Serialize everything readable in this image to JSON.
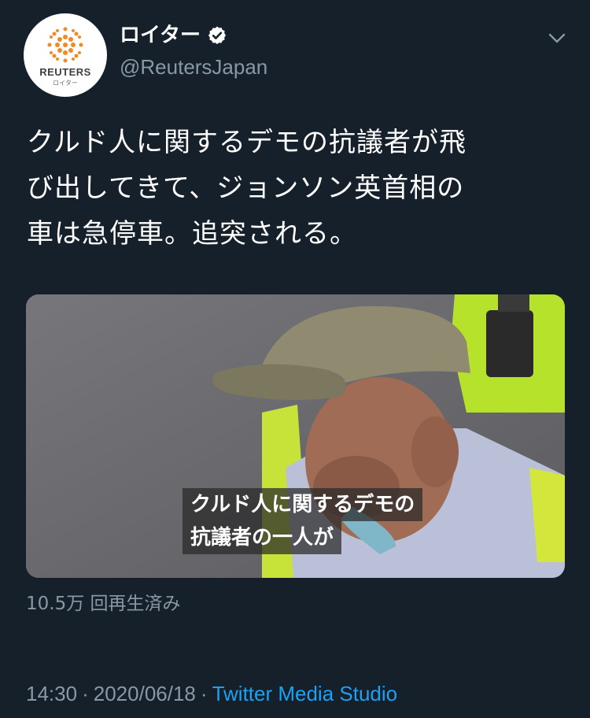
{
  "account": {
    "display_name": "ロイター",
    "handle": "@ReutersJapan",
    "verified_icon": "verified-badge-icon",
    "avatar_brand": "REUTERS",
    "avatar_brand_sub": "ロイター"
  },
  "menu_icon": "chevron-down-icon",
  "tweet": {
    "lines": [
      "クルド人に関するデモの抗議者が飛",
      "び出してきて、ジョンソン英首相の",
      "車は急停車。追突される。"
    ]
  },
  "video": {
    "caption_lines": [
      "クルド人に関するデモの",
      "抗議者の一人が"
    ]
  },
  "views": "10.5万 回再生済み",
  "meta": {
    "time": "14:30",
    "separator": "·",
    "date": "2020/06/18",
    "source": "Twitter Media Studio"
  },
  "colors": {
    "background": "#15202b",
    "secondary_text": "#8899a6",
    "link": "#1da1f2",
    "reuters_orange": "#f08a24"
  }
}
